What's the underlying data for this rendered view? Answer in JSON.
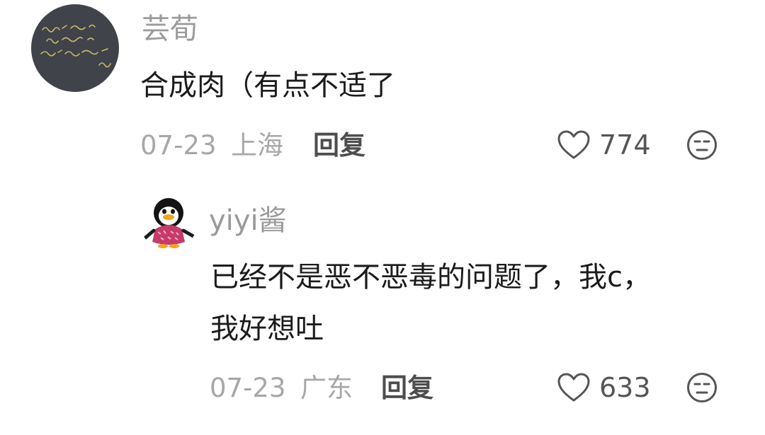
{
  "comments": [
    {
      "username": "芸荀",
      "text_lines": [
        "合成肉（有点不适了"
      ],
      "date": "07-23",
      "location": "上海",
      "reply_label": "回复",
      "likes": "774",
      "avatar": "chalkboard-handwriting-avatar"
    },
    {
      "username": "yiyi酱",
      "text_lines": [
        "已经不是恶不恶毒的问题了，我c，",
        "我好想吐"
      ],
      "date": "07-23",
      "location": "广东",
      "reply_label": "回复",
      "likes": "633",
      "avatar": "penguin-avatar"
    }
  ],
  "icons": {
    "like": "heart-outline-icon",
    "dislike": "neutral-face-icon"
  },
  "colors": {
    "username": "#9a9a9a",
    "meta": "#a7a7a7",
    "reply": "#4d4d4d",
    "text": "#1b1b1b"
  }
}
